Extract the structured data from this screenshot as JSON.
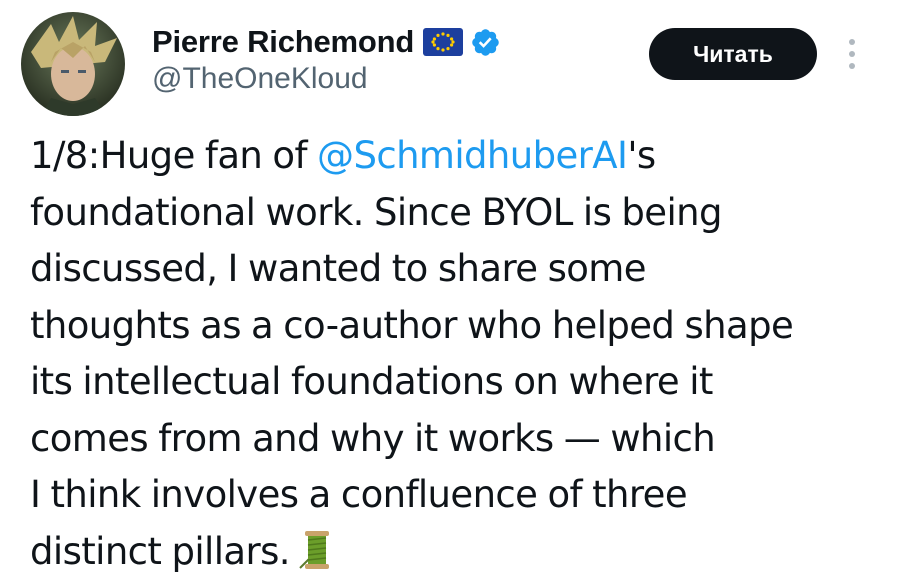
{
  "author": {
    "display_name": "Pierre Richemond",
    "handle": "@TheOneKloud",
    "flag_icon": "eu-flag-icon",
    "verified_icon": "verified-badge-icon",
    "verified_color": "#1d9bf0"
  },
  "header": {
    "follow_label": "Читать",
    "more_icon": "more-vertical-icon"
  },
  "tweet": {
    "line1_prefix": "1/8:Huge fan of ",
    "line1_mention": "@SchmidhuberAI",
    "line1_suffix": "'s",
    "line2": "foundational work. Since BYOL is being",
    "line3": "discussed, I wanted to share some",
    "line4": "thoughts as a co-author who helped shape",
    "line5": "its intellectual foundations on where it",
    "line6": "comes from and why it works — which",
    "line7": "I think involves a confluence of three",
    "line8": "distinct pillars.",
    "emoji_icon": "thread-spool-icon"
  },
  "colors": {
    "text": "#0f1419",
    "secondary": "#536471",
    "link": "#1d9bf0",
    "button_bg": "#0f1419",
    "button_text": "#ffffff"
  }
}
